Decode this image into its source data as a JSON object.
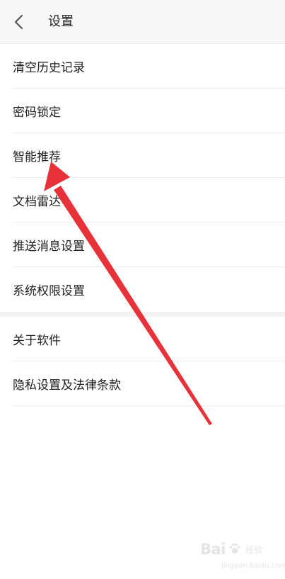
{
  "header": {
    "title": "设置"
  },
  "settings": {
    "group1": [
      {
        "label": "清空历史记录"
      },
      {
        "label": "密码锁定"
      },
      {
        "label": "智能推荐"
      },
      {
        "label": "文档雷达"
      },
      {
        "label": "推送消息设置"
      },
      {
        "label": "系统权限设置"
      }
    ],
    "group2": [
      {
        "label": "关于软件"
      },
      {
        "label": "隐私设置及法律条款"
      }
    ]
  },
  "annotation": {
    "arrow_color": "#e8323a"
  },
  "watermark": {
    "brand": "Bai",
    "jingyan": "经验",
    "url": "jingyan.baidu.com"
  },
  "colors": {
    "background": "#ffffff",
    "header_bg": "#f7f7f7",
    "divider": "#ededed",
    "section_gap": "#f2f2f2"
  }
}
